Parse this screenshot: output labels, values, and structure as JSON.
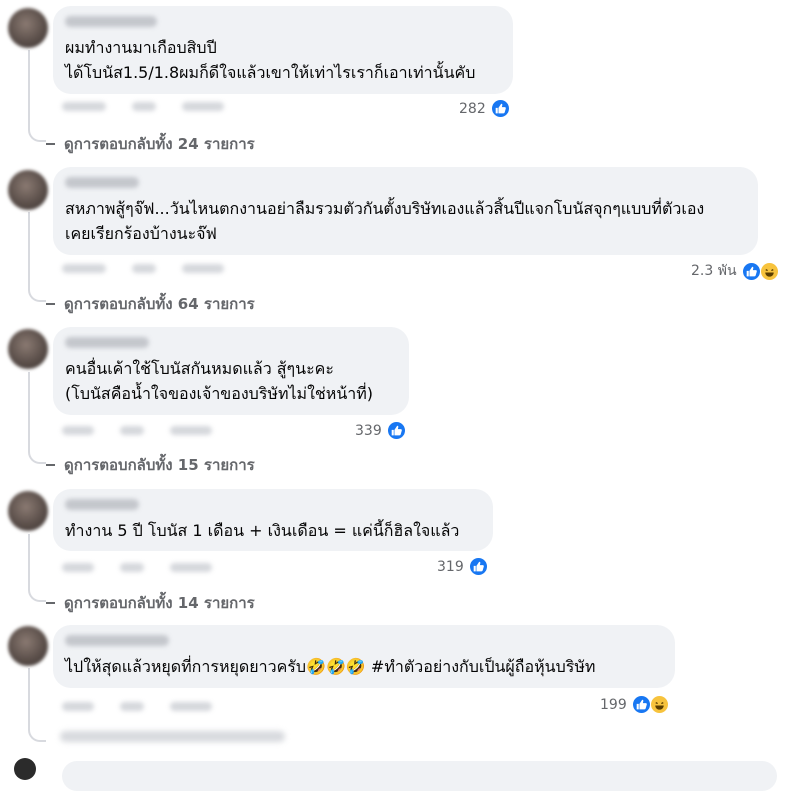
{
  "comments": [
    {
      "text": "ผมทำงานมาเกือบสิบปี\nได้โบนัส1.5/1.8ผมก็ดีใจแล้วเขาให้เท่าไรเราก็เอาเท่านั้นคับ",
      "reaction_count": "282",
      "reactions": [
        "like-icon"
      ],
      "replies_label": "ดูการตอบกลับทั้ง 24 รายการ"
    },
    {
      "text": "สหภาพสู้ๆจ๊ฟ...วันไหนตกงานอย่าลืมรวมตัวกันตั้งบริษัทเองแล้วสิ้นปีแจกโบนัสจุกๆแบบที่ตัวเอง\nเคยเรียกร้องบ้างนะจ๊ฟ",
      "reaction_count": "2.3 พัน",
      "reactions": [
        "like-icon",
        "haha-icon"
      ],
      "replies_label": "ดูการตอบกลับทั้ง 64 รายการ"
    },
    {
      "text": "คนอื่นเค้าใช้โบนัสกันหมดแล้ว สู้ๆนะคะ\n(โบนัสคือน้ำใจของเจ้าของบริษัทไม่ใช่หน้าที่)",
      "reaction_count": "339",
      "reactions": [
        "like-icon"
      ],
      "replies_label": "ดูการตอบกลับทั้ง 15 รายการ"
    },
    {
      "text": "ทำงาน 5 ปี โบนัส 1 เดือน + เงินเดือน = แค่นี้ก็ฮิลใจแล้ว",
      "reaction_count": "319",
      "reactions": [
        "like-icon"
      ],
      "replies_label": "ดูการตอบกลับทั้ง 14 รายการ"
    },
    {
      "text": "ไปให้สุดแล้วหยุดที่การหยุดยาวครับ🤣🤣🤣 #ทำตัวอย่างกับเป็นผู้ถือหุ้นบริษัท",
      "reaction_count": "199",
      "reactions": [
        "like-icon",
        "haha-icon"
      ]
    }
  ],
  "colors": {
    "bubble": "#f0f2f5",
    "like": "#1877f2",
    "haha": "#f7c33d",
    "secondary_text": "#65676b"
  }
}
